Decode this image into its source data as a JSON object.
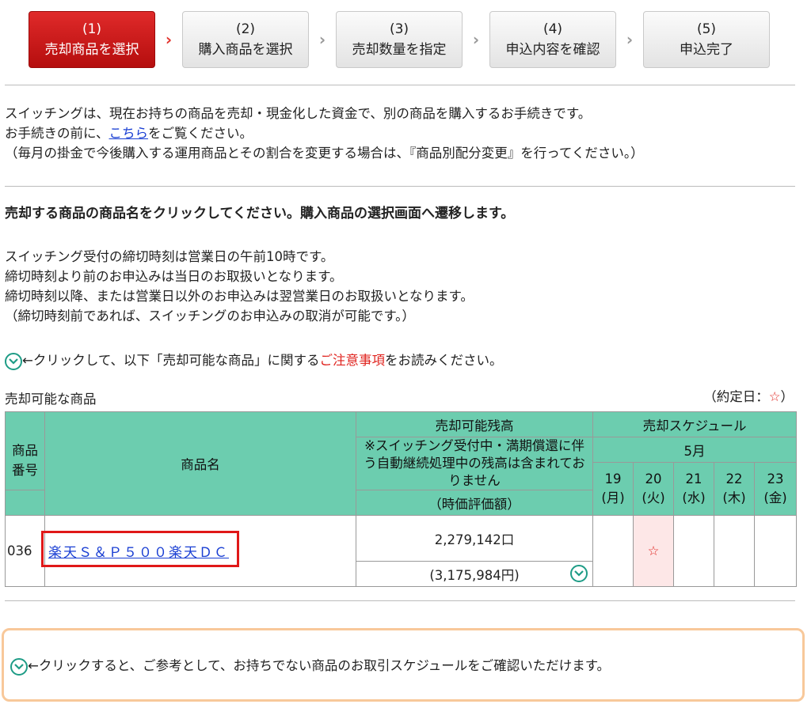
{
  "steps": [
    {
      "num": "(1)",
      "label": "売却商品を選択",
      "active": true
    },
    {
      "num": "(2)",
      "label": "購入商品を選択",
      "active": false
    },
    {
      "num": "(3)",
      "label": "売却数量を指定",
      "active": false
    },
    {
      "num": "(4)",
      "label": "申込内容を確認",
      "active": false
    },
    {
      "num": "(5)",
      "label": "申込完了",
      "active": false
    }
  ],
  "intro": {
    "line1": "スイッチングは、現在お持ちの商品を売却・現金化した資金で、別の商品を購入するお手続きです。",
    "line2_pre": "お手続きの前に、",
    "line2_link": "こちら",
    "line2_post": "をご覧ください。",
    "line3": "（毎月の掛金で今後購入する運用商品とその割合を変更する場合は、『商品別配分変更』を行ってください。）"
  },
  "heading": "売却する商品の商品名をクリックしてください。購入商品の選択画面へ遷移します。",
  "rules": [
    "スイッチング受付の締切時刻は営業日の午前10時です。",
    "締切時刻より前のお申込みは当日のお取扱いとなります。",
    "締切時刻以降、または営業日以外のお申込みは翌営業日のお取扱いとなります。",
    "（締切時刻前であれば、スイッチングのお申込みの取消が可能です。）"
  ],
  "notice_line": {
    "pre": "←クリックして、以下「売却可能な商品」に関する",
    "red": "ご注意事項",
    "post": "をお読みください。"
  },
  "table_caption": "売却可能な商品",
  "legend": {
    "pre": "（約定日：",
    "star": "☆",
    "post": "）"
  },
  "table": {
    "col_code": "商品番号",
    "col_name": "商品名",
    "col_balance": "売却可能残高",
    "col_balance_note": "※スイッチング受付中・満期償還に伴う自動継続処理中の残高は含まれておりません",
    "col_valuation": "（時価評価額）",
    "col_schedule": "売却スケジュール",
    "month": "5月",
    "days": [
      {
        "day": "19",
        "dow": "(月)"
      },
      {
        "day": "20",
        "dow": "(火)"
      },
      {
        "day": "21",
        "dow": "(水)"
      },
      {
        "day": "22",
        "dow": "(木)"
      },
      {
        "day": "23",
        "dow": "(金)"
      }
    ],
    "rows": [
      {
        "code": "036",
        "name": "楽天Ｓ＆Ｐ５００楽天ＤＣ",
        "units": "2,279,142口",
        "value": "(3,175,984円)",
        "star": "☆"
      }
    ]
  },
  "bottom_notice": "←クリックすると、ご参考として、お持ちでない商品のお取引スケジュールをご確認いただけます。",
  "colors": {
    "accent_red": "#d11616",
    "table_header": "#6ccdaf",
    "toggle": "#1e9c86",
    "notice_border": "#f8c89a"
  }
}
